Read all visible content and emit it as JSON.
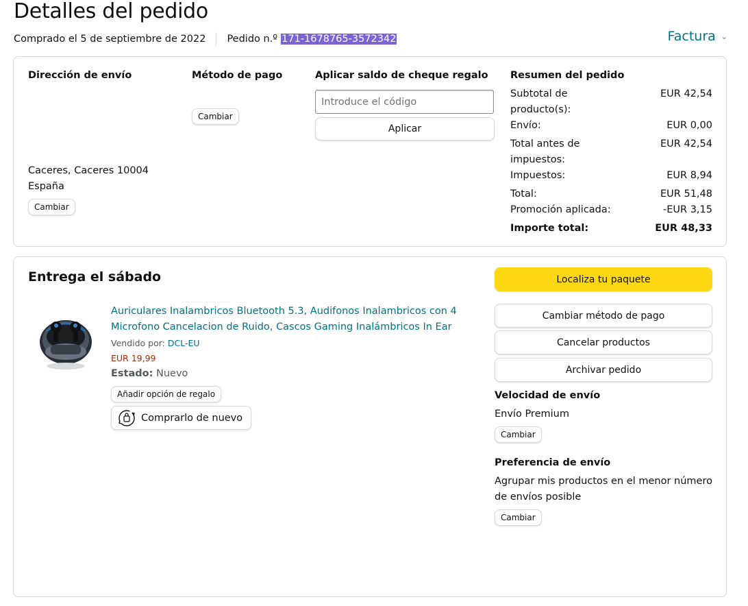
{
  "header": {
    "title": "Detalles del pedido",
    "purchased": "Comprado el 5 de septiembre de 2022",
    "order_label": "Pedido n.º",
    "order_number": "171-1678765-3572342",
    "invoice": "Factura"
  },
  "shipping_address": {
    "heading": "Dirección de envío",
    "line_city": "Caceres, Caceres 10004",
    "line_country": "España",
    "change": "Cambiar"
  },
  "payment": {
    "heading": "Método de pago",
    "change": "Cambiar"
  },
  "gift_card": {
    "heading": "Aplicar saldo de cheque regalo",
    "placeholder": "Introduce el código",
    "apply": "Aplicar"
  },
  "summary": {
    "heading": "Resumen del pedido",
    "rows": [
      {
        "label": "Subtotal de producto(s):",
        "value": "EUR 42,54"
      },
      {
        "label": "Envío:",
        "value": "EUR 0,00"
      },
      {
        "label": "Total antes de impuestos:",
        "value": "EUR 42,54"
      },
      {
        "label": "Impuestos:",
        "value": "EUR 8,94"
      },
      {
        "label": "Total:",
        "value": "EUR 51,48"
      },
      {
        "label": "Promoción aplicada:",
        "value": "-EUR 3,15"
      }
    ],
    "total_label": "Importe total:",
    "total_value": "EUR 48,33"
  },
  "shipment": {
    "title": "Entrega el sábado",
    "product_title": "Auriculares Inalambricos Bluetooth 5.3, Audifonos Inalambricos con 4 Microfono Cancelacion de Ruido, Cascos Gaming Inalámbricos In Ear",
    "sold_by_label": "Vendido por:",
    "seller": "DCL-EU",
    "price": "EUR 19,99",
    "state_label": "Estado:",
    "state_value": "Nuevo",
    "gift_option": "Añadir opción de regalo",
    "buy_again": "Comprarlo de nuevo"
  },
  "actions": {
    "track": "Localiza tu paquete",
    "change_payment": "Cambiar método de pago",
    "cancel": "Cancelar productos",
    "archive": "Archivar pedido"
  },
  "delivery_speed": {
    "heading": "Velocidad de envío",
    "value": "Envío Premium",
    "change": "Cambiar"
  },
  "delivery_pref": {
    "heading": "Preferencia de envío",
    "value": "Agrupar mis productos en el menor número de envíos posible",
    "change": "Cambiar"
  },
  "colors": {
    "link": "#007185",
    "price": "#B12704",
    "primary_button": "#FFD814",
    "highlight": "#7B63D6"
  }
}
